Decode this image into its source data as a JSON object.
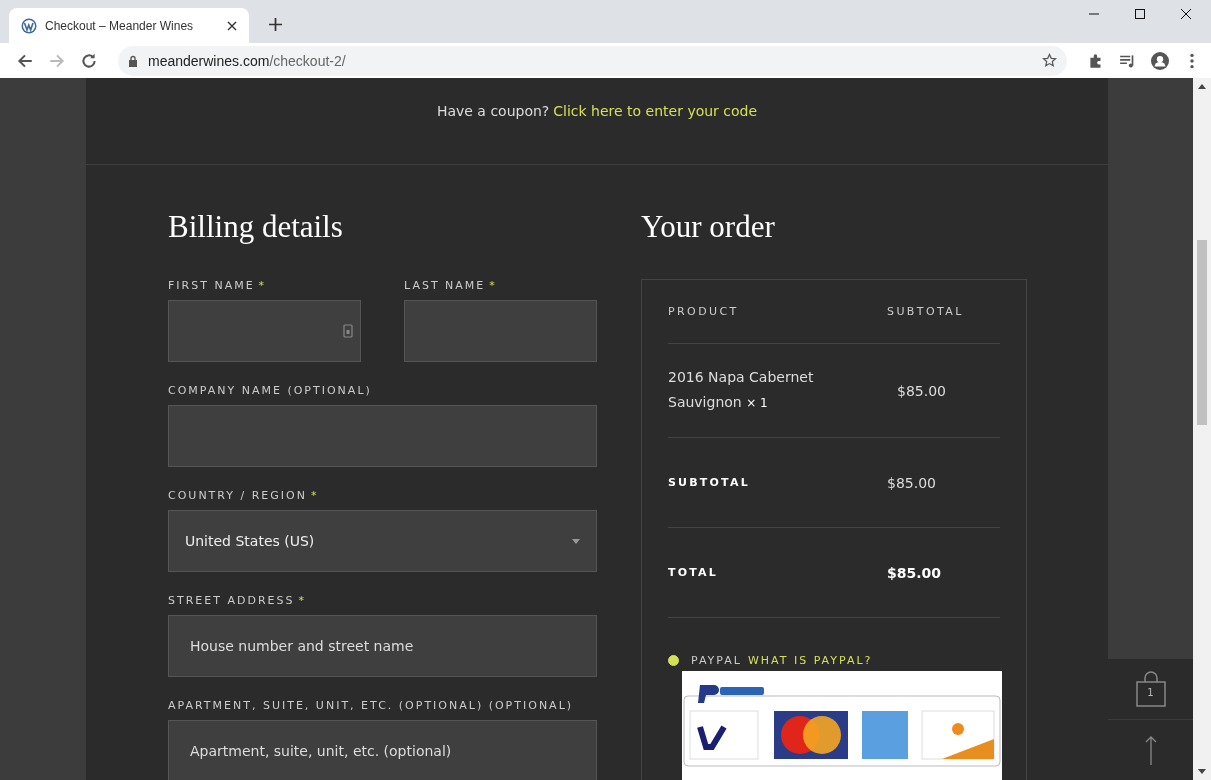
{
  "browser": {
    "tab_title": "Checkout – Meander Wines",
    "address_domain": "meanderwines.com",
    "address_path": "/checkout-2/"
  },
  "coupon": {
    "text": "Have a coupon?",
    "link": "Click here to enter your code"
  },
  "billing": {
    "title": "Billing details",
    "fields": [
      {
        "label": "FIRST NAME",
        "required_mark": "*",
        "kind": "text",
        "half": true,
        "autofill": true
      },
      {
        "label": "LAST NAME",
        "required_mark": "*",
        "kind": "text",
        "half": true
      },
      {
        "label": "COMPANY NAME (OPTIONAL)",
        "kind": "text"
      },
      {
        "label": "COUNTRY / REGION",
        "required_mark": "*",
        "kind": "select",
        "value": "United States (US)"
      },
      {
        "label": "STREET ADDRESS",
        "required_mark": "*",
        "kind": "text",
        "placeholder": "House number and street name"
      },
      {
        "label": "APARTMENT, SUITE, UNIT, ETC. (OPTIONAL) (OPTIONAL)",
        "kind": "text",
        "placeholder": "Apartment, suite, unit, etc. (optional)"
      }
    ]
  },
  "order": {
    "title": "Your order",
    "columns": [
      "PRODUCT",
      "SUBTOTAL"
    ],
    "items": [
      {
        "name": "2016 Napa Cabernet Sauvignon",
        "quantity": "× 1",
        "price": "$85.00"
      }
    ],
    "totals": [
      {
        "label": "SUBTOTAL",
        "value": "$85.00",
        "kind": "subtotal"
      },
      {
        "label": "TOTAL",
        "value": "$85.00",
        "kind": "total"
      }
    ],
    "payment": {
      "label": "PAYPAL",
      "link": "WHAT IS PAYPAL?",
      "selected": true
    }
  },
  "side": {
    "cart_count": "1"
  }
}
